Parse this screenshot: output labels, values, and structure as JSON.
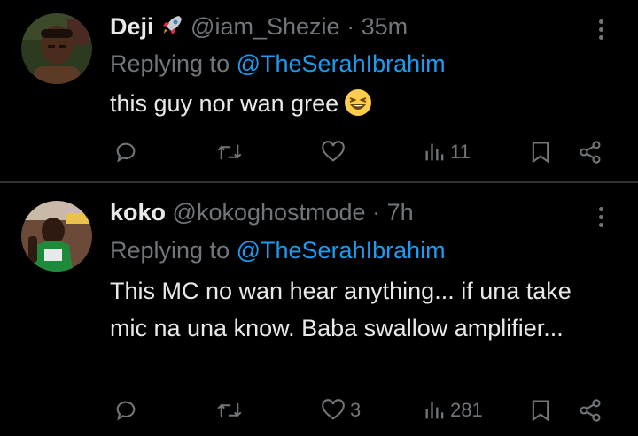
{
  "tweets": [
    {
      "name": "Deji",
      "handle": "@iam_Shezie",
      "separator": "·",
      "time": "35m",
      "replying_prefix": "Replying to",
      "replying_to": "@TheSerahIbrahim",
      "text": "this guy nor wan gree",
      "stats": {
        "replies": "",
        "retweets": "",
        "likes": "",
        "views": "11"
      },
      "name_emoji": "rocket-emoji",
      "text_emoji": "laughing-face-emoji"
    },
    {
      "name": "koko",
      "handle": "@kokoghostmode",
      "separator": "·",
      "time": "7h",
      "replying_prefix": "Replying to",
      "replying_to": "@TheSerahIbrahim",
      "text": "This MC no wan hear anything... if una take mic na una know. Baba swallow amplifier...",
      "stats": {
        "replies": "",
        "retweets": "",
        "likes": "3",
        "views": "281"
      }
    }
  ],
  "colors": {
    "background": "#000000",
    "text": "#e7e9ea",
    "muted": "#71767b",
    "link": "#1d9bf0",
    "divider": "#2f3336"
  },
  "icons": [
    "reply-icon",
    "retweet-icon",
    "like-icon",
    "views-icon",
    "bookmark-icon",
    "share-icon",
    "more-icon"
  ]
}
